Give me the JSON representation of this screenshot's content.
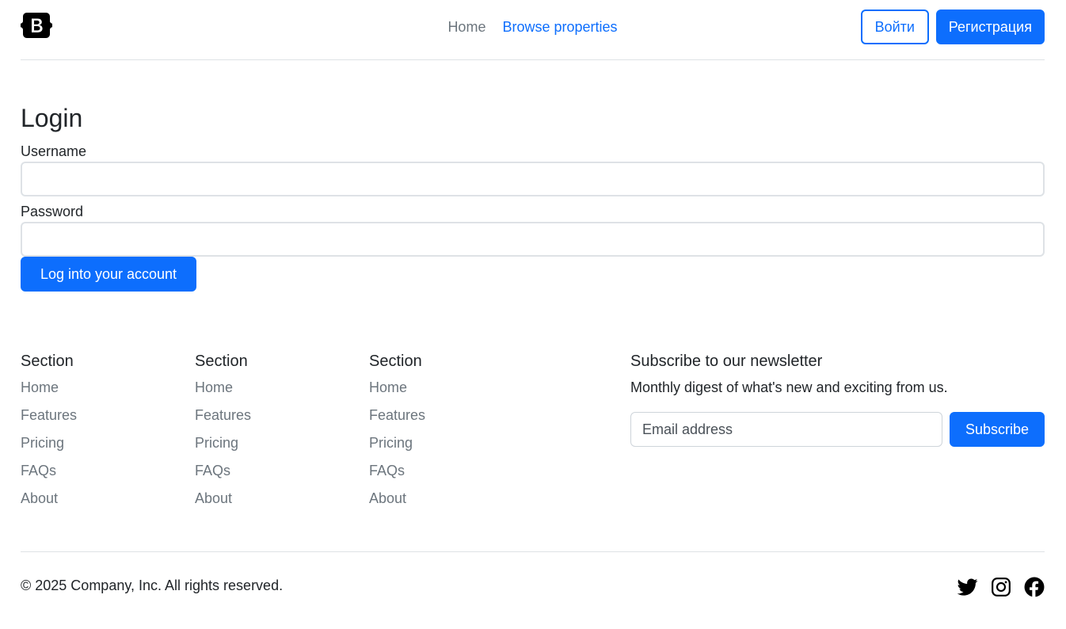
{
  "header": {
    "nav": [
      {
        "label": "Home"
      },
      {
        "label": "Browse properties"
      }
    ],
    "login_label": "Войти",
    "register_label": "Регистрация"
  },
  "login": {
    "title": "Login",
    "username_label": "Username",
    "password_label": "Password",
    "submit_label": "Log into your account"
  },
  "footer": {
    "columns": [
      {
        "title": "Section",
        "links": [
          "Home",
          "Features",
          "Pricing",
          "FAQs",
          "About"
        ]
      },
      {
        "title": "Section",
        "links": [
          "Home",
          "Features",
          "Pricing",
          "FAQs",
          "About"
        ]
      },
      {
        "title": "Section",
        "links": [
          "Home",
          "Features",
          "Pricing",
          "FAQs",
          "About"
        ]
      }
    ],
    "newsletter": {
      "title": "Subscribe to our newsletter",
      "text": "Monthly digest of what's new and exciting from us.",
      "placeholder": "Email address",
      "button": "Subscribe"
    },
    "copyright": "© 2025 Company, Inc. All rights reserved.",
    "social": [
      "twitter-icon",
      "instagram-icon",
      "facebook-icon"
    ]
  },
  "colors": {
    "primary": "#0d6efd",
    "muted": "#6c757d",
    "border": "#dee2e6"
  }
}
